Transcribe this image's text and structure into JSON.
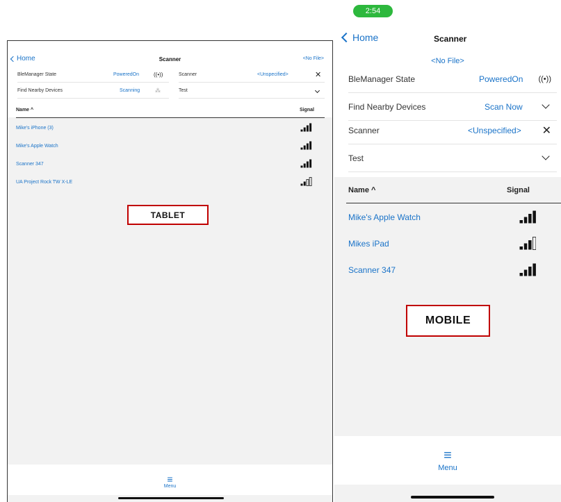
{
  "tablet": {
    "nav": {
      "back_label": "Home",
      "title": "Scanner",
      "file": "<No File>"
    },
    "rows": {
      "ble_label": "BleManager State",
      "ble_value": "PoweredOn",
      "scanner_label": "Scanner",
      "scanner_value": "<Unspecified>",
      "find_label": "Find Nearby Devices",
      "find_value": "Scanning",
      "test_label": "Test"
    },
    "table": {
      "col_name": "Name ^",
      "col_signal": "Signal",
      "devices": [
        {
          "name": "Mike's iPhone (3)",
          "signal_bars": 4
        },
        {
          "name": "Mike's Apple Watch",
          "signal_bars": 4
        },
        {
          "name": "Scanner 347",
          "signal_bars": 4
        },
        {
          "name": "UA Project Rock TW X-LE",
          "signal_bars": 2
        }
      ]
    },
    "badge": "TABLET",
    "menu_label": "Menu"
  },
  "mobile": {
    "time": "2:54",
    "nav": {
      "back_label": "Home",
      "title": "Scanner",
      "file": "<No File>"
    },
    "rows": {
      "ble_label": "BleManager State",
      "ble_value": "PoweredOn",
      "find_label": "Find Nearby Devices",
      "find_value": "Scan Now",
      "scanner_label": "Scanner",
      "scanner_value": "<Unspecified>",
      "test_label": "Test"
    },
    "table": {
      "col_name": "Name ^",
      "col_signal": "Signal",
      "devices": [
        {
          "name": "Mike's Apple Watch",
          "signal_bars": 4
        },
        {
          "name": "Mikes iPad",
          "signal_bars": 3
        },
        {
          "name": "Scanner 347",
          "signal_bars": 4
        }
      ]
    },
    "badge": "MOBILE",
    "menu_label": "Menu"
  },
  "colors": {
    "accent": "#1a73c8",
    "badge_border": "#c00000",
    "time_pill": "#2db83d"
  },
  "icons": [
    "chevron-left-icon",
    "broadcast-icon",
    "close-icon",
    "chevron-down-icon",
    "spinner-icon",
    "signal-icon",
    "menu-icon",
    "sort-up-icon"
  ]
}
